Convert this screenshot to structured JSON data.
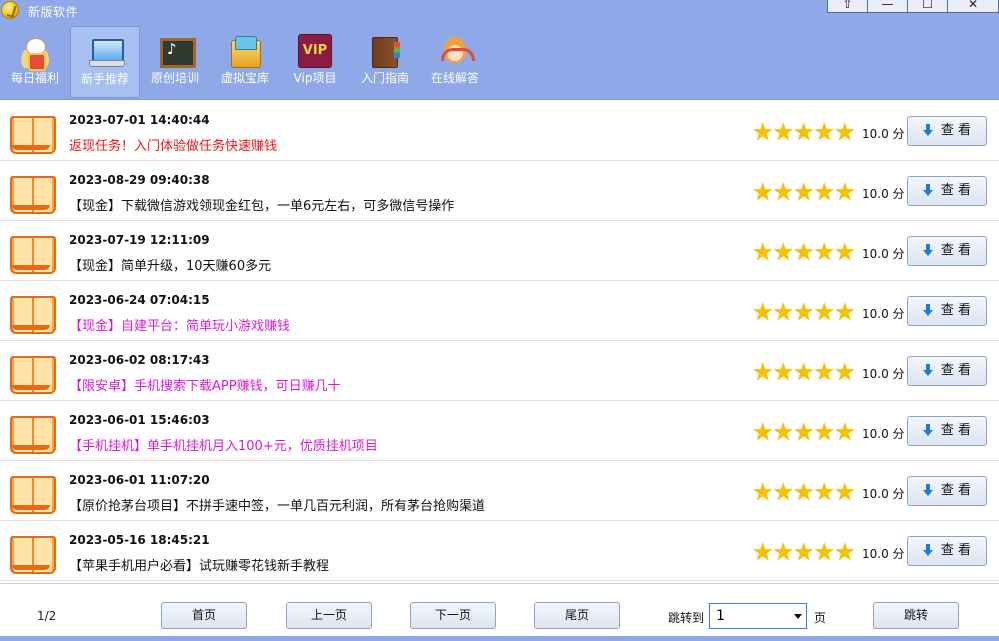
{
  "window": {
    "title": "新版软件",
    "controls": [
      "⇧",
      "—",
      "☐",
      "✕"
    ]
  },
  "toolbar": {
    "items": [
      {
        "label": "每日福利",
        "icon": "lucky-cat-icon",
        "active": false
      },
      {
        "label": "新手推荐",
        "icon": "laptop-icon",
        "active": true
      },
      {
        "label": "原创培训",
        "icon": "chalkboard-icon",
        "active": false
      },
      {
        "label": "虚拟宝库",
        "icon": "treasure-cash-icon",
        "active": false
      },
      {
        "label": "Vip项目",
        "icon": "vip-icon",
        "active": false
      },
      {
        "label": "入门指南",
        "icon": "guide-book-icon",
        "active": false
      },
      {
        "label": "在线解答",
        "icon": "support-agent-icon",
        "active": false
      }
    ],
    "vip_text": "VIP"
  },
  "list": {
    "rows": [
      {
        "date": "2023-07-01 14:40:44",
        "title": "返现任务！入门体验做任务快速赚钱",
        "color": "#e8171b",
        "score": "10.0 分",
        "button": "查 看"
      },
      {
        "date": "2023-08-29 09:40:38",
        "title": "【现金】下载微信游戏领现金红包，一单6元左右，可多微信号操作",
        "color": "#111111",
        "score": "10.0 分",
        "button": "查 看"
      },
      {
        "date": "2023-07-19 12:11:09",
        "title": "【现金】简单升级，10天赚60多元",
        "color": "#111111",
        "score": "10.0 分",
        "button": "查 看"
      },
      {
        "date": "2023-06-24 07:04:15",
        "title": "【现金】自建平台：简单玩小游戏赚钱",
        "color": "#d81bd6",
        "score": "10.0 分",
        "button": "查 看"
      },
      {
        "date": "2023-06-02 08:17:43",
        "title": "【限安卓】手机搜索下载APP赚钱，可日赚几十",
        "color": "#d81bd6",
        "score": "10.0 分",
        "button": "查 看"
      },
      {
        "date": "2023-06-01 15:46:03",
        "title": "【手机挂机】单手机挂机月入100+元，优质挂机项目",
        "color": "#d81bd6",
        "score": "10.0 分",
        "button": "查 看"
      },
      {
        "date": "2023-06-01 11:07:20",
        "title": "【原价抢茅台项目】不拼手速中签，一单几百元利润，所有茅台抢购渠道",
        "color": "#111111",
        "score": "10.0 分",
        "button": "查 看"
      },
      {
        "date": "2023-05-16 18:45:21",
        "title": "【苹果手机用户必看】试玩赚零花钱新手教程",
        "color": "#111111",
        "score": "10.0 分",
        "button": "查 看"
      }
    ],
    "stars_per_row": 5
  },
  "footer": {
    "page_info": "1/2",
    "first": "首页",
    "prev": "上一页",
    "next": "下一页",
    "last": "尾页",
    "jump_label": "跳转到",
    "jump_value": "1",
    "page_unit": "页",
    "jump_button": "跳转"
  }
}
